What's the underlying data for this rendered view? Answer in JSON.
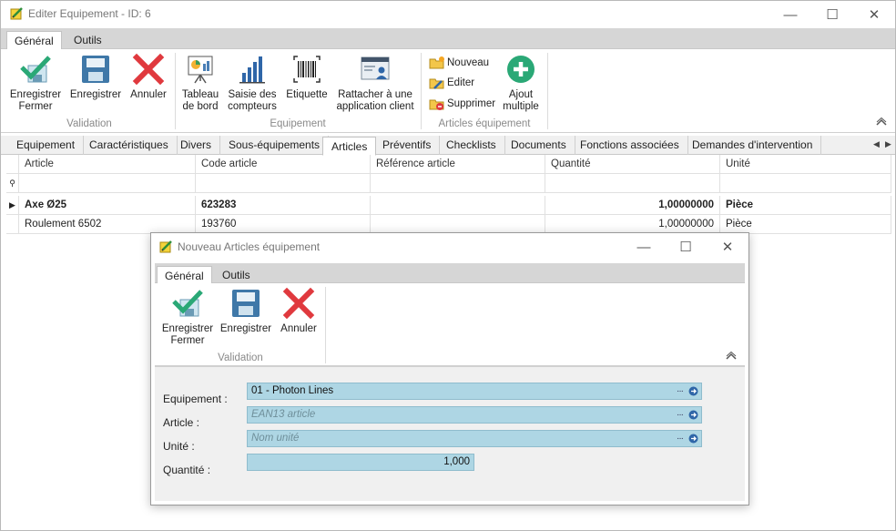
{
  "window": {
    "title": "Editer Equipement - ID: 6",
    "minimize": "—",
    "maximize": "☐",
    "close": "✕"
  },
  "ribbon": {
    "tabs": [
      "Général",
      "Outils"
    ],
    "buttons": {
      "save_close": [
        "Enregistrer",
        "Fermer"
      ],
      "save": "Enregistrer",
      "cancel": "Annuler",
      "dashboard": [
        "Tableau",
        "de bord"
      ],
      "counters": [
        "Saisie des",
        "compteurs"
      ],
      "label": "Etiquette",
      "attach": [
        "Rattacher à une",
        "application client"
      ],
      "new": "Nouveau",
      "edit": "Editer",
      "delete": "Supprimer",
      "bulk_add": [
        "Ajout",
        "multiple"
      ]
    },
    "groups": [
      "Validation",
      "Equipement",
      "Articles équipement"
    ]
  },
  "content_tabs": [
    "Equipement",
    "Caractéristiques",
    "Divers",
    "Sous-équipements",
    "Articles",
    "Préventifs",
    "Checklists",
    "Documents",
    "Fonctions associées",
    "Demandes d'intervention"
  ],
  "grid": {
    "columns": [
      "Article",
      "Code article",
      "Référence article",
      "Quantité",
      "Unité"
    ],
    "rows": [
      [
        "Axe Ø25",
        "623283",
        "",
        "1,00000000",
        "Pièce"
      ],
      [
        "Roulement 6502",
        "193760",
        "",
        "1,00000000",
        "Pièce"
      ]
    ]
  },
  "dialog": {
    "title": "Nouveau Articles équipement",
    "tabs": [
      "Général",
      "Outils"
    ],
    "buttons": {
      "save_close": [
        "Enregistrer",
        "Fermer"
      ],
      "save": "Enregistrer",
      "cancel": "Annuler"
    },
    "group": "Validation",
    "form": {
      "equipement_label": "Equipement :",
      "equipement_value": "01 - Photon Lines",
      "article_label": "Article :",
      "article_placeholder": "EAN13 article",
      "unite_label": "Unité :",
      "unite_placeholder": "Nom unité",
      "quantite_label": "Quantité :",
      "quantite_value": "1,000",
      "dots": "···"
    }
  },
  "colors": {
    "accent_green": "#2aa876",
    "field_blue": "#aed6e4",
    "cancel_red": "#e0393e",
    "save_blue": "#3f78a8"
  }
}
